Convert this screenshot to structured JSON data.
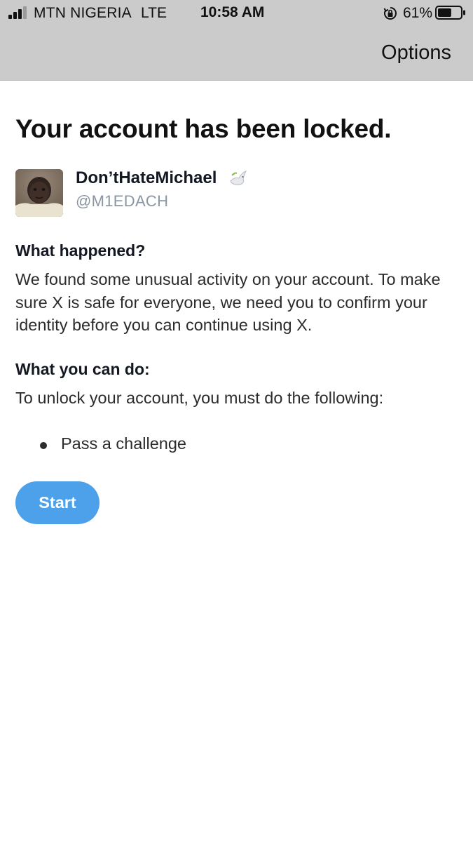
{
  "status_bar": {
    "carrier": "MTN NIGERIA",
    "network": "LTE",
    "time": "10:58 AM",
    "battery_percent": "61%",
    "battery_level": 0.61,
    "signal_bars": 3
  },
  "nav": {
    "options_label": "Options"
  },
  "page": {
    "title": "Your account has been locked."
  },
  "account": {
    "display_name": "Don’tHateMichael",
    "name_emoji": "dove-icon",
    "handle": "@M1EDACH"
  },
  "what_happened": {
    "heading": "What happened?",
    "body": "We found some unusual activity on your account. To make sure X is safe for everyone, we need you to confirm your identity before you can continue using X."
  },
  "what_you_can_do": {
    "heading": "What you can do:",
    "body": "To unlock your account, you must do the following:",
    "steps": [
      "Pass a challenge"
    ]
  },
  "actions": {
    "start_label": "Start"
  },
  "colors": {
    "top_bar_bg": "#cbcbcb",
    "primary_button": "#4da0ea",
    "handle_text": "#8a96a3"
  }
}
